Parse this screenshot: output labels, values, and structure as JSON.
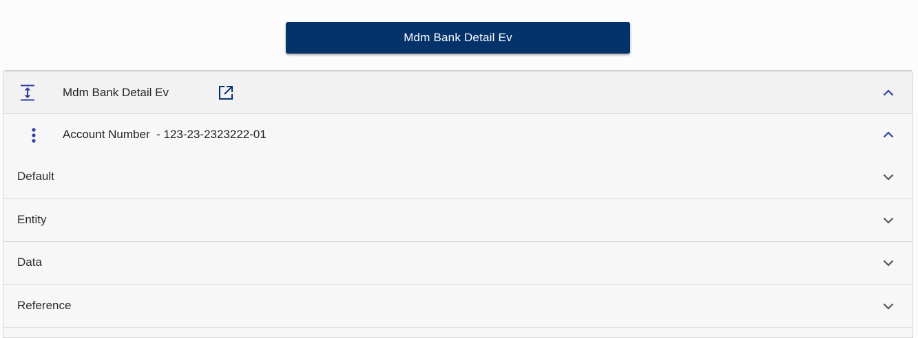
{
  "top_button": {
    "label": "Mdm Bank Detail Ev"
  },
  "panel": {
    "header": {
      "title": "Mdm Bank Detail Ev",
      "expand_icon": "expand-vertical-icon",
      "open_icon": "open-in-new-icon",
      "toggle_icon": "chevron-up-icon"
    },
    "account": {
      "label": "Account Number",
      "separator": "-",
      "value": "123-23-2323222-01",
      "menu_icon": "more-vertical-icon",
      "toggle_icon": "chevron-up-icon"
    },
    "sections": [
      {
        "label": "Default"
      },
      {
        "label": "Entity"
      },
      {
        "label": "Data"
      },
      {
        "label": "Reference"
      }
    ]
  },
  "colors": {
    "primary": "#04336b",
    "icon_blue": "#2d3fa3",
    "chevron_gray": "#555555"
  }
}
